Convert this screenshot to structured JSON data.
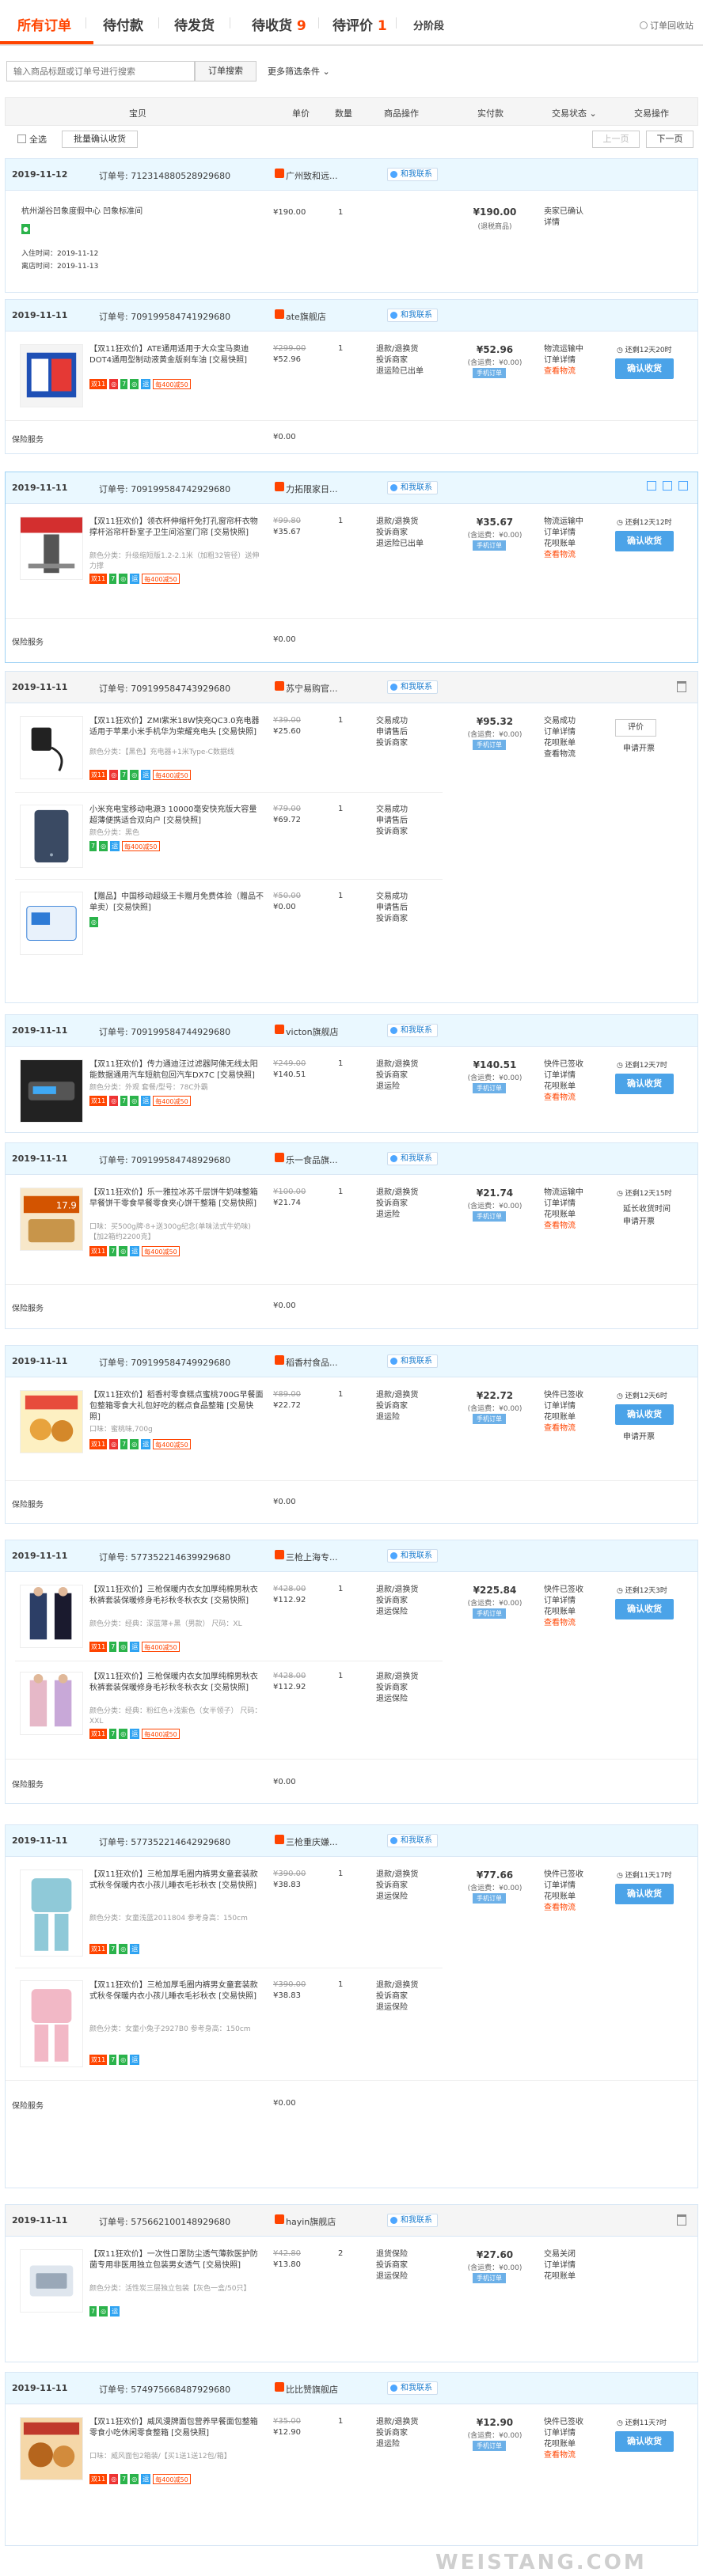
{
  "tabs": [
    {
      "label": "所有订单",
      "count": ""
    },
    {
      "label": "待付款",
      "count": ""
    },
    {
      "label": "待发货",
      "count": ""
    },
    {
      "label": "待收货",
      "count": "9"
    },
    {
      "label": "待评价",
      "count": "1"
    },
    {
      "label": "分阶段",
      "count": ""
    }
  ],
  "recycle_label": "订单回收站",
  "search": {
    "placeholder": "输入商品标题或订单号进行搜索",
    "button": "订单搜索",
    "more": "更多筛选条件 ⌄"
  },
  "header": {
    "product": "宝贝",
    "price": "单价",
    "qty": "数量",
    "ops": "商品操作",
    "paid": "实付款",
    "status": "交易状态 ⌄",
    "actions": "交易操作"
  },
  "controls": {
    "select_all": "全选",
    "batch_confirm": "批量确认收货",
    "prev": "上一页",
    "next": "下一页"
  },
  "chat_label": "和我联系",
  "insurance_label": "保险服务",
  "orders": [
    {
      "date": "2019-11-12",
      "order_no": "订单号: 712314880528929680",
      "shop": "广州致和远..."
    },
    {
      "date": "2019-11-11",
      "order_no": "订单号: 709199584741929680",
      "shop": "ate旗舰店"
    },
    {
      "date": "2019-11-11",
      "order_no": "订单号: 709199584742929680",
      "shop": "力拓限家日..."
    },
    {
      "date": "2019-11-11",
      "order_no": "订单号: 709199584743929680",
      "shop": "苏宁易购官..."
    },
    {
      "date": "2019-11-11",
      "order_no": "订单号: 709199584744929680",
      "shop": "victon旗舰店"
    },
    {
      "date": "2019-11-11",
      "order_no": "订单号: 709199584748929680",
      "shop": "乐一食品旗..."
    },
    {
      "date": "2019-11-11",
      "order_no": "订单号: 709199584749929680",
      "shop": "稻香村食品..."
    },
    {
      "date": "2019-11-11",
      "order_no": "订单号: 577352214639929680",
      "shop": "三枪上海专..."
    },
    {
      "date": "2019-11-11",
      "order_no": "订单号: 577352214642929680",
      "shop": "三枪重庆嫌..."
    },
    {
      "date": "2019-11-11",
      "order_no": "订单号: 575662100148929680",
      "shop": "hayin旗舰店"
    },
    {
      "date": "2019-11-11",
      "order_no": "订单号: 574975668487929680",
      "shop": "比比赞旗舰店"
    }
  ],
  "o1": {
    "title": "杭州湖谷凹象度假中心 凹象标准间",
    "checkin": "入住时间：2019-11-12",
    "checkout": "离店时间：2019-11-13",
    "price": "¥190.00",
    "qty": "1",
    "total": "¥190.00",
    "total_sub": "(退税商品)",
    "status1": "卖家已确认",
    "status2": "详情"
  },
  "o2": {
    "title": "【双11狂欢价】ATE通用适用于大众宝马奥迪DOT4通用型制动液黄金版刹车油 [交易快照]",
    "orig": "¥299.00",
    "price": "¥52.96",
    "qty": "1",
    "ops": [
      "退款/退换货",
      "投诉商家",
      "退运险已出单"
    ],
    "total": "¥52.96",
    "total_sub": "(含运费：¥0.00)",
    "badge": "手机订单",
    "status": [
      "物流运输中",
      "订单详情",
      "查看物流"
    ],
    "remain": "还剩12天20时",
    "confirm": "确认收货",
    "ins_val": "¥0.00"
  },
  "o3": {
    "title": "【双11狂欢价】领衣杯伸缩杆免打孔窗帘杆衣物撑杆浴帘杆卧室子卫生间浴室门帘 [交易快照]",
    "meta": "颜色分类：升级缩短版1.2-2.1米（加粗32管径）送伸力撑",
    "orig": "¥99.80",
    "price": "¥35.67",
    "qty": "1",
    "ops": [
      "退款/退换货",
      "投诉商家",
      "退运险已出单"
    ],
    "total": "¥35.67",
    "total_sub": "(含运费：¥0.00)",
    "badge": "手机订单",
    "status": [
      "物流运输中",
      "订单详情",
      "花呗账单",
      "查看物流"
    ],
    "remain": "还剩12天12时",
    "confirm": "确认收货",
    "ins_val": "¥0.00"
  },
  "o4": {
    "items": [
      {
        "title": "【双11狂欢价】ZMI紫米18W快充QC3.0充电器适用于苹果小米手机华为荣耀充电头 [交易快照]",
        "meta": "颜色分类：【黑色】充电器+1米Type-C数据线",
        "orig": "¥39.00",
        "price": "¥25.60",
        "qty": "1",
        "ops": [
          "交易成功",
          "申请售后",
          "投诉商家"
        ]
      },
      {
        "title": "小米充电宝移动电源3 10000毫安快充版大容量超薄便携适合双向户 [交易快照]",
        "meta": "颜色分类：黑色",
        "orig": "¥79.00",
        "price": "¥69.72",
        "qty": "1",
        "ops": [
          "交易成功",
          "申请售后",
          "投诉商家"
        ]
      },
      {
        "title": "【赠品】中国移动超级王卡赠月免费体验（赠品不单卖）[交易快照]",
        "meta": "",
        "orig": "¥50.00",
        "price": "¥0.00",
        "qty": "1",
        "ops": [
          "交易成功",
          "申请售后",
          "投诉商家"
        ]
      }
    ],
    "total": "¥95.32",
    "total_sub": "(含运费：¥0.00)",
    "badge": "手机订单",
    "status": [
      "交易成功",
      "订单详情",
      "花呗账单",
      "查看物流"
    ],
    "review": "评价",
    "extra": "申请开票"
  },
  "o5": {
    "title": "【双11狂欢价】传力通迪汪过滤器阿佛无线太阳能数据通用汽车短航包回汽车DX7C [交易快照]",
    "meta": "颜色分类：外观  套餐/型号：78C外霸",
    "orig": "¥249.00",
    "price": "¥140.51",
    "qty": "1",
    "ops": [
      "退款/退换货",
      "投诉商家",
      "退运险"
    ],
    "total": "¥140.51",
    "total_sub": "(含运费：¥0.00)",
    "badge": "手机订单",
    "status": [
      "快件已签收",
      "订单详情",
      "花呗账单",
      "查看物流"
    ],
    "remain": "还剩12天7时",
    "confirm": "确认收货"
  },
  "o6": {
    "title": "【双11狂欢价】乐一雅拉冰苏千层饼牛奶味整箱早餐饼干零食早餐零食夹心饼干整箱 [交易快照]",
    "meta": "口味：买500g牌·8+送300g纪念(单味法式牛奶味) 【加2箱约2200克】",
    "orig": "¥100.00",
    "price": "¥21.74",
    "qty": "1",
    "ops": [
      "退款/退换货",
      "投诉商家",
      "退运险"
    ],
    "total": "¥21.74",
    "total_sub": "(含运费：¥0.00)",
    "badge": "手机订单",
    "status": [
      "物流运输中",
      "订单详情",
      "花呗账单",
      "查看物流"
    ],
    "remain": "还剩12天15时",
    "light": "延长收货时间",
    "extra": "申请开票",
    "ins_val": "¥0.00"
  },
  "o7": {
    "title": "【双11狂欢价】稻香村零食糕点蜜桃700G早餐面包整箱零食大礼包好吃的糕点食品整箱 [交易快照]",
    "meta": "口味：蜜桃味,700g",
    "orig": "¥89.00",
    "price": "¥22.72",
    "qty": "1",
    "ops": [
      "退款/退换货",
      "投诉商家",
      "退运险"
    ],
    "total": "¥22.72",
    "total_sub": "(含运费：¥0.00)",
    "badge": "手机订单",
    "status": [
      "快件已签收",
      "订单详情",
      "花呗账单",
      "查看物流"
    ],
    "remain": "还剩12天6时",
    "confirm": "确认收货",
    "extra": "申请开票",
    "ins_val": "¥0.00"
  },
  "o8": {
    "items": [
      {
        "title": "【双11狂欢价】三枪保暖内衣女加厚纯棉男秋衣秋裤套装保暖修身毛衫秋冬秋衣女 [交易快照]",
        "meta": "颜色分类：经典：深蓝薄+黑（男款） 尺码：XL",
        "orig": "¥428.00",
        "price": "¥112.92",
        "qty": "1",
        "ops": [
          "退款/退换货",
          "投诉商家",
          "退运保险"
        ]
      },
      {
        "title": "【双11狂欢价】三枪保暖内衣女加厚纯棉男秋衣秋裤套装保暖修身毛衫秋冬秋衣女 [交易快照]",
        "meta": "颜色分类：经典：粉红色+浅紫色（女半领子） 尺码：XXL",
        "orig": "¥428.00",
        "price": "¥112.92",
        "qty": "1",
        "ops": [
          "退款/退换货",
          "投诉商家",
          "退运保险"
        ]
      }
    ],
    "total": "¥225.84",
    "total_sub": "(含运费：¥0.00)",
    "badge": "手机订单",
    "status": [
      "快件已签收",
      "订单详情",
      "花呗账单",
      "查看物流"
    ],
    "remain": "还剩12天3时",
    "confirm": "确认收货",
    "ins_val": "¥0.00"
  },
  "o9": {
    "items": [
      {
        "title": "【双11狂欢价】三枪加厚毛圈内裤男女童套装款式秋冬保暖内衣小孩儿睡衣毛衫秋衣 [交易快照]",
        "meta": "颜色分类：女童浅蓝2011804  参考身高：150cm",
        "orig": "¥390.00",
        "price": "¥38.83",
        "qty": "1",
        "ops": [
          "退款/退换货",
          "投诉商家",
          "退运保险"
        ]
      },
      {
        "title": "【双11狂欢价】三枪加厚毛圈内裤男女童套装款式秋冬保暖内衣小孩儿睡衣毛衫秋衣 [交易快照]",
        "meta": "颜色分类：女童小兔子2927B0  参考身高：150cm",
        "orig": "¥390.00",
        "price": "¥38.83",
        "qty": "1",
        "ops": [
          "退款/退换货",
          "投诉商家",
          "退运保险"
        ]
      }
    ],
    "total": "¥77.66",
    "total_sub": "(含运费：¥0.00)",
    "badge": "手机订单",
    "status": [
      "快件已签收",
      "订单详情",
      "花呗账单",
      "查看物流"
    ],
    "remain": "还剩11天17时",
    "confirm": "确认收货",
    "ins_val": "¥0.00"
  },
  "o10": {
    "title": "【双11狂欢价】一次性口罩防尘透气薄款医护防菌专用非医用独立包装男女透气 [交易快照]",
    "meta": "颜色分类：活性炭三层独立包装【灰色一盒/50只】",
    "orig": "¥42.80",
    "price": "¥13.80",
    "qty": "2",
    "ops": [
      "退货保险",
      "投诉商家",
      "退运保险"
    ],
    "total": "¥27.60",
    "total_sub": "(含运费：¥0.00)",
    "badge": "手机订单",
    "status": [
      "交易关闭",
      "订单详情",
      "花呗账单"
    ]
  },
  "o11": {
    "title": "【双11狂欢价】威风漫牌面包营养早餐面包整箱零食小吃休闲零食整箱 [交易快照]",
    "meta": "口味：威风面包2箱装/【买1送1送12包/箱】",
    "orig": "¥35.00",
    "price": "¥12.90",
    "qty": "1",
    "ops": [
      "退款/退换货",
      "投诉商家",
      "退运险"
    ],
    "total": "¥12.90",
    "total_sub": "(含运费：¥0.00)",
    "badge": "手机订单",
    "status": [
      "快件已签收",
      "订单详情",
      "花呗账单",
      "查看物流"
    ],
    "remain": "还剩11天?时",
    "confirm": "确认收货"
  },
  "watermark": "WEISTANG.COM"
}
